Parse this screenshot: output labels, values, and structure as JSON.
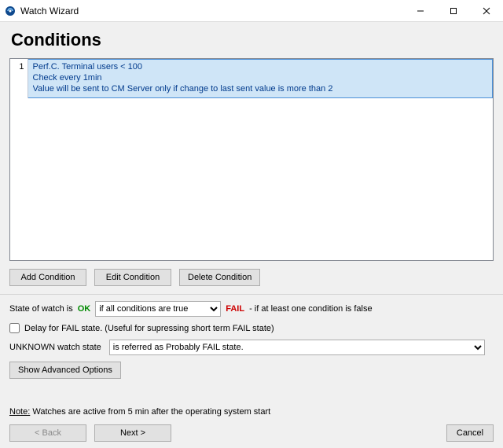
{
  "window": {
    "title": "Watch Wizard"
  },
  "heading": "Conditions",
  "conditions": [
    {
      "index": "1",
      "line1": "Perf.C. Terminal users < 100",
      "line2": "Check every 1min",
      "line3": "Value will be sent to CM Server only if change to last sent value is more than 2"
    }
  ],
  "buttons": {
    "add": "Add Condition",
    "edit": "Edit Condition",
    "delete": "Delete Condition",
    "show_advanced": "Show Advanced Options",
    "back": "< Back",
    "next": "Next >",
    "cancel": "Cancel"
  },
  "state": {
    "prefix": "State of watch is ",
    "ok_word": "OK",
    "combo_selected": "if all conditions are true",
    "fail_word": "FAIL",
    "fail_suffix": " - if at least one condition is false"
  },
  "delay": {
    "checked": false,
    "label": "Delay for FAIL state. (Useful for supressing short term FAIL state)"
  },
  "unknown": {
    "label": "UNKNOWN watch state",
    "combo_selected": "is referred as Probably FAIL state."
  },
  "note": {
    "label": "Note:",
    "text": " Watches are active from 5 min after the operating system start"
  }
}
